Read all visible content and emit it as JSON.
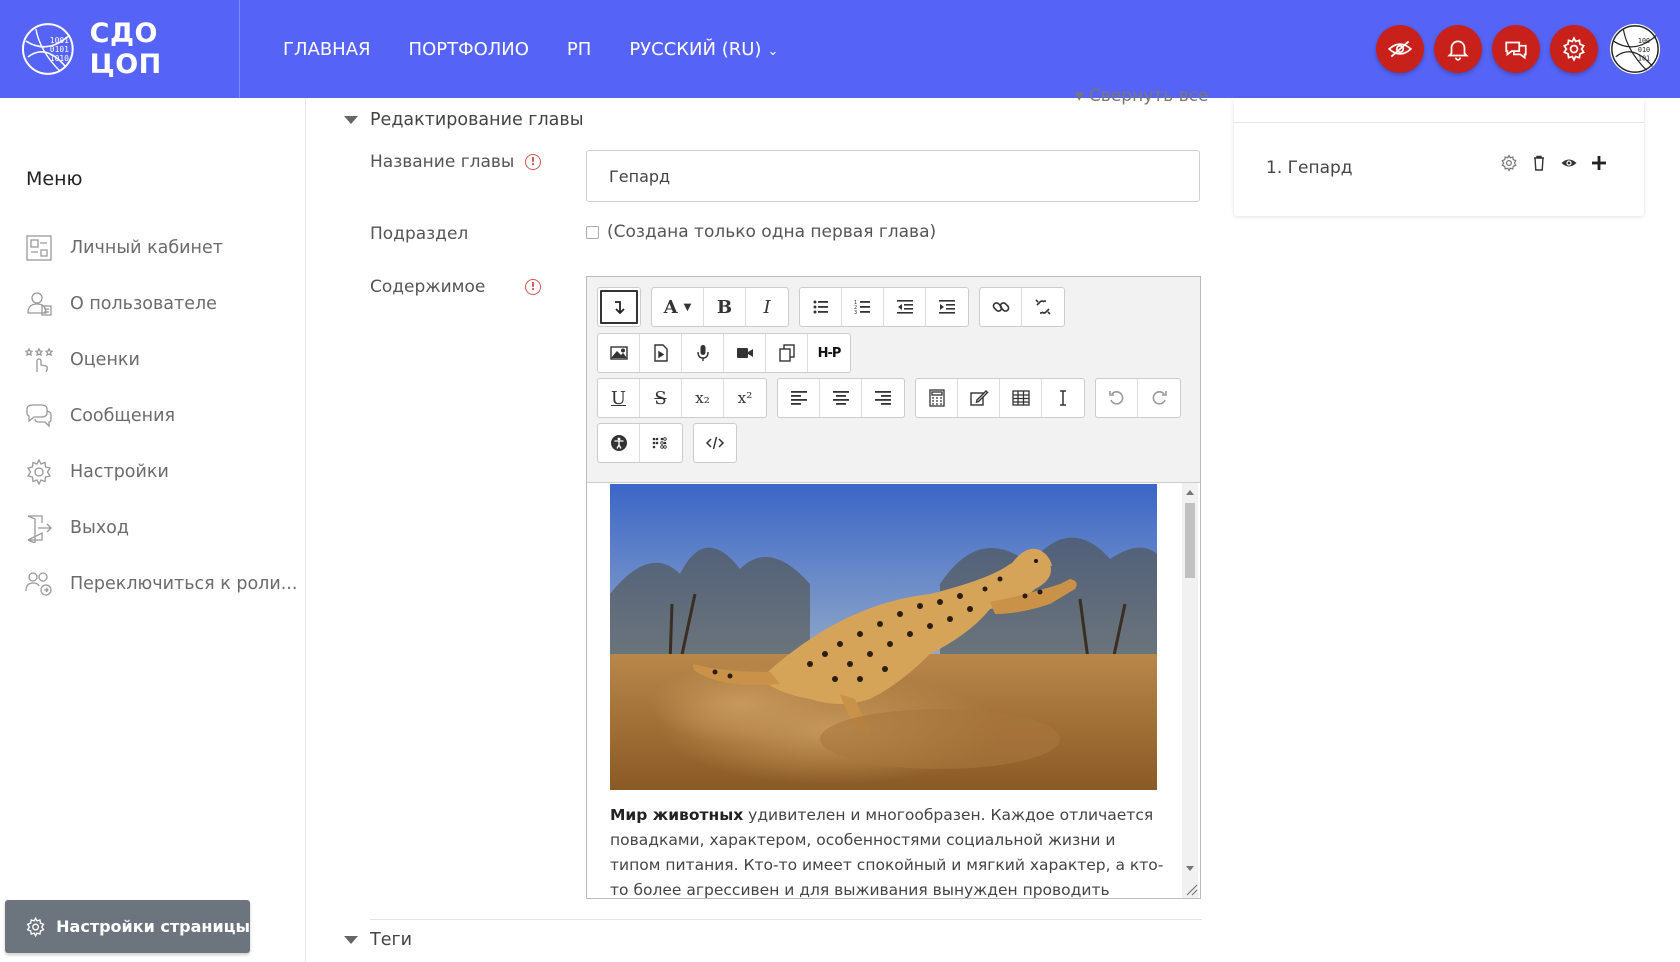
{
  "navbar": {
    "brand": "СДО ЦОП",
    "links": [
      "ГЛАВНАЯ",
      "ПОРТФОЛИО",
      "РП",
      "РУССКИЙ (RU)"
    ],
    "icons": [
      "eye-slash-icon",
      "bell-icon",
      "chat-icon",
      "gear-icon"
    ],
    "accent_color": "#5564f7",
    "icon_bg_color": "#c8201a"
  },
  "drawer": {
    "title": "Меню",
    "items": [
      {
        "label": "Личный кабинет",
        "icon": "dashboard-icon"
      },
      {
        "label": "О пользователе",
        "icon": "profile-icon"
      },
      {
        "label": "Оценки",
        "icon": "grades-icon"
      },
      {
        "label": "Сообщения",
        "icon": "messages-icon"
      },
      {
        "label": "Настройки",
        "icon": "settings-icon"
      },
      {
        "label": "Выход",
        "icon": "logout-icon"
      },
      {
        "label": "Переключиться к роли...",
        "icon": "switch-role-icon"
      }
    ],
    "page_settings_label": "Настройки страницы"
  },
  "main": {
    "collapse_all": "Свернуть все",
    "section_title": "Редактирование главы",
    "chapter_name_label": "Название главы",
    "chapter_name_value": "Гепард",
    "subsection_label": "Подраздел",
    "subsection_note": "(Создана только одна первая глава)",
    "content_label": "Содержимое",
    "content_bold": "Мир животных",
    "content_text": " удивителен и многообразен. Каждое отличается повадками, характером, особенностями социальной жизни и типом питания. Кто-то имеет спокойный и мягкий характер, а кто-то более агрессивен и для выживания вынужден проводить большую часть",
    "tags_label": "Теги",
    "toolbar": {
      "h5p": "H-P",
      "font_letter": "A",
      "bold": "B",
      "italic": "I",
      "underline": "U",
      "strike": "S",
      "subscript": "x₂",
      "superscript": "x²"
    }
  },
  "toc": {
    "item": "1. Гепард"
  }
}
